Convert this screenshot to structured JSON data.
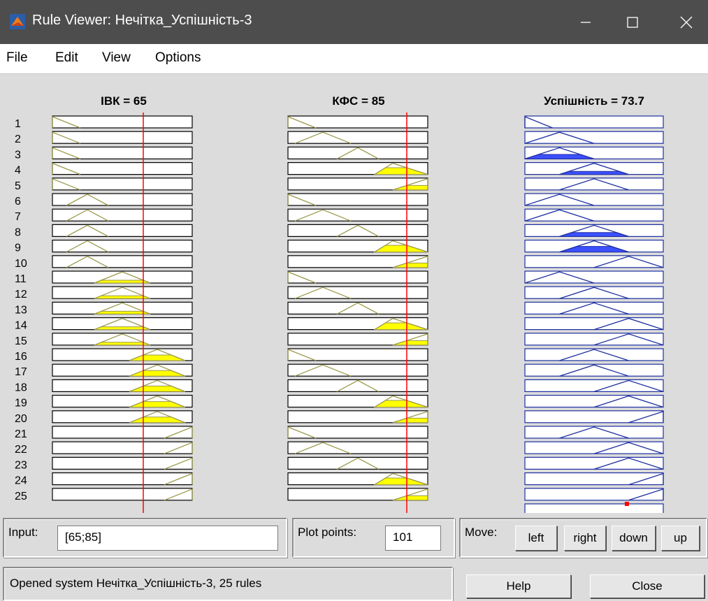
{
  "window": {
    "title": "Rule Viewer: Нечітка_Успішність-3",
    "controls": [
      "minimize",
      "maximize",
      "close"
    ]
  },
  "menu": [
    "File",
    "Edit",
    "View",
    "Options"
  ],
  "inputs": [
    {
      "label": "ІВК = 65",
      "value": 65,
      "range": [
        0,
        100
      ]
    },
    {
      "label": "КФС = 85",
      "value": 85,
      "range": [
        0,
        100
      ]
    }
  ],
  "output": {
    "label": "Успішність = 73.7",
    "value": 73.7,
    "range": [
      0,
      100
    ]
  },
  "terms": {
    "ivk": {
      "1": [
        0,
        0,
        20
      ],
      "2": [
        10,
        25,
        40
      ],
      "3": [
        30,
        50,
        70
      ],
      "4": [
        55,
        75,
        95
      ],
      "5": [
        80,
        100,
        100
      ]
    },
    "kfs": {
      "1": [
        0,
        0,
        20
      ],
      "2": [
        5,
        25,
        45
      ],
      "3": [
        35,
        50,
        65
      ],
      "4": [
        62,
        75,
        100
      ],
      "5": [
        75,
        100,
        100
      ]
    },
    "out": {
      "1": [
        0,
        0,
        20
      ],
      "2": [
        0,
        25,
        50
      ],
      "3": [
        0,
        25,
        50
      ],
      "4": [
        25,
        50,
        75
      ],
      "5": [
        50,
        75,
        100
      ],
      "6": [
        75,
        100,
        100
      ]
    }
  },
  "rules": [
    {
      "n": "1",
      "ivk": "1",
      "kfs": "1",
      "out": "1",
      "fill": 0
    },
    {
      "n": "2",
      "ivk": "1",
      "kfs": "2",
      "out": "2",
      "fill": 0
    },
    {
      "n": "3",
      "ivk": "1",
      "kfs": "3",
      "out": "3",
      "fill": 0.4
    },
    {
      "n": "4",
      "ivk": "1",
      "kfs": "4",
      "out": "4",
      "fill": 0.27
    },
    {
      "n": "5",
      "ivk": "1",
      "kfs": "5",
      "out": "4",
      "fill": 0
    },
    {
      "n": "6",
      "ivk": "2",
      "kfs": "1",
      "out": "2",
      "fill": 0
    },
    {
      "n": "7",
      "ivk": "2",
      "kfs": "2",
      "out": "2",
      "fill": 0
    },
    {
      "n": "8",
      "ivk": "2",
      "kfs": "3",
      "out": "4",
      "fill": 0.35
    },
    {
      "n": "9",
      "ivk": "2",
      "kfs": "4",
      "out": "4",
      "fill": 0.5
    },
    {
      "n": "10",
      "ivk": "2",
      "kfs": "5",
      "out": "5",
      "fill": 0
    },
    {
      "n": "11",
      "ivk": "3",
      "kfs": "1",
      "out": "2",
      "fill": 0
    },
    {
      "n": "12",
      "ivk": "3",
      "kfs": "2",
      "out": "4",
      "fill": 0
    },
    {
      "n": "13",
      "ivk": "3",
      "kfs": "3",
      "out": "4",
      "fill": 0
    },
    {
      "n": "14",
      "ivk": "3",
      "kfs": "4",
      "out": "5",
      "fill": 0
    },
    {
      "n": "15",
      "ivk": "3",
      "kfs": "5",
      "out": "5",
      "fill": 0
    },
    {
      "n": "16",
      "ivk": "4",
      "kfs": "1",
      "out": "4",
      "fill": 0
    },
    {
      "n": "17",
      "ivk": "4",
      "kfs": "2",
      "out": "4",
      "fill": 0
    },
    {
      "n": "18",
      "ivk": "4",
      "kfs": "3",
      "out": "5",
      "fill": 0
    },
    {
      "n": "19",
      "ivk": "4",
      "kfs": "4",
      "out": "5",
      "fill": 0
    },
    {
      "n": "20",
      "ivk": "4",
      "kfs": "5",
      "out": "6",
      "fill": 0
    },
    {
      "n": "21",
      "ivk": "5",
      "kfs": "1",
      "out": "4",
      "fill": 0
    },
    {
      "n": "22",
      "ivk": "5",
      "kfs": "2",
      "out": "5",
      "fill": 0
    },
    {
      "n": "23",
      "ivk": "5",
      "kfs": "3",
      "out": "5",
      "fill": 0
    },
    {
      "n": "24",
      "ivk": "5",
      "kfs": "4",
      "out": "6",
      "fill": 0
    },
    {
      "n": "25",
      "ivk": "5",
      "kfs": "5",
      "out": "6",
      "fill": 0
    }
  ],
  "colors": {
    "input_fill": "#ffff00",
    "input_curve": "#9c9a4c",
    "output_fill": "#3c50ff",
    "output_curve": "#1c2ea0",
    "indicator": "#ff0000"
  },
  "controls": {
    "input_label": "Input:",
    "input_value": "[65;85]",
    "plot_points_label": "Plot points:",
    "plot_points_value": "101",
    "move_label": "Move:",
    "left": "left",
    "right": "right",
    "down": "down",
    "up": "up",
    "help": "Help",
    "close": "Close"
  },
  "status": "Opened system Нечітка_Успішність-3, 25 rules"
}
